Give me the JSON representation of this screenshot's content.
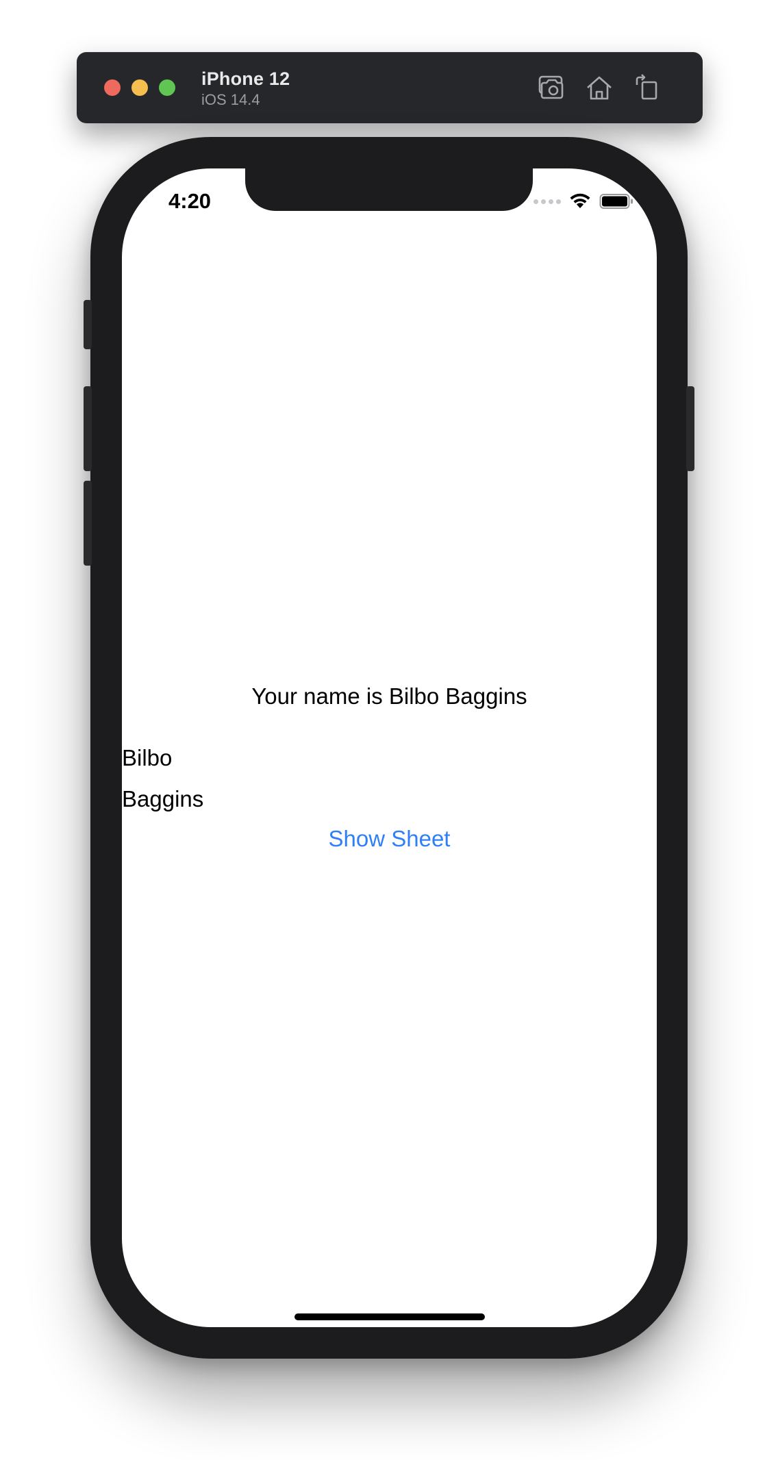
{
  "simulator": {
    "device_name": "iPhone 12",
    "os_version": "iOS 14.4",
    "toolbar_icons": [
      "screenshot-icon",
      "home-icon",
      "rotate-icon"
    ]
  },
  "status_bar": {
    "time": "4:20",
    "icons": [
      "cellular-signal-icon",
      "wifi-icon",
      "battery-icon"
    ]
  },
  "content": {
    "headline": "Your name is Bilbo Baggins",
    "first_name": "Bilbo",
    "last_name": "Baggins",
    "show_sheet_button": "Show Sheet"
  },
  "colors": {
    "accent": "#2f7ff6",
    "toolbar_bg": "#26272b",
    "device_frame": "#1c1c1e",
    "traffic_red": "#ee6a5f",
    "traffic_yellow": "#f5be4f",
    "traffic_green": "#61c554"
  }
}
